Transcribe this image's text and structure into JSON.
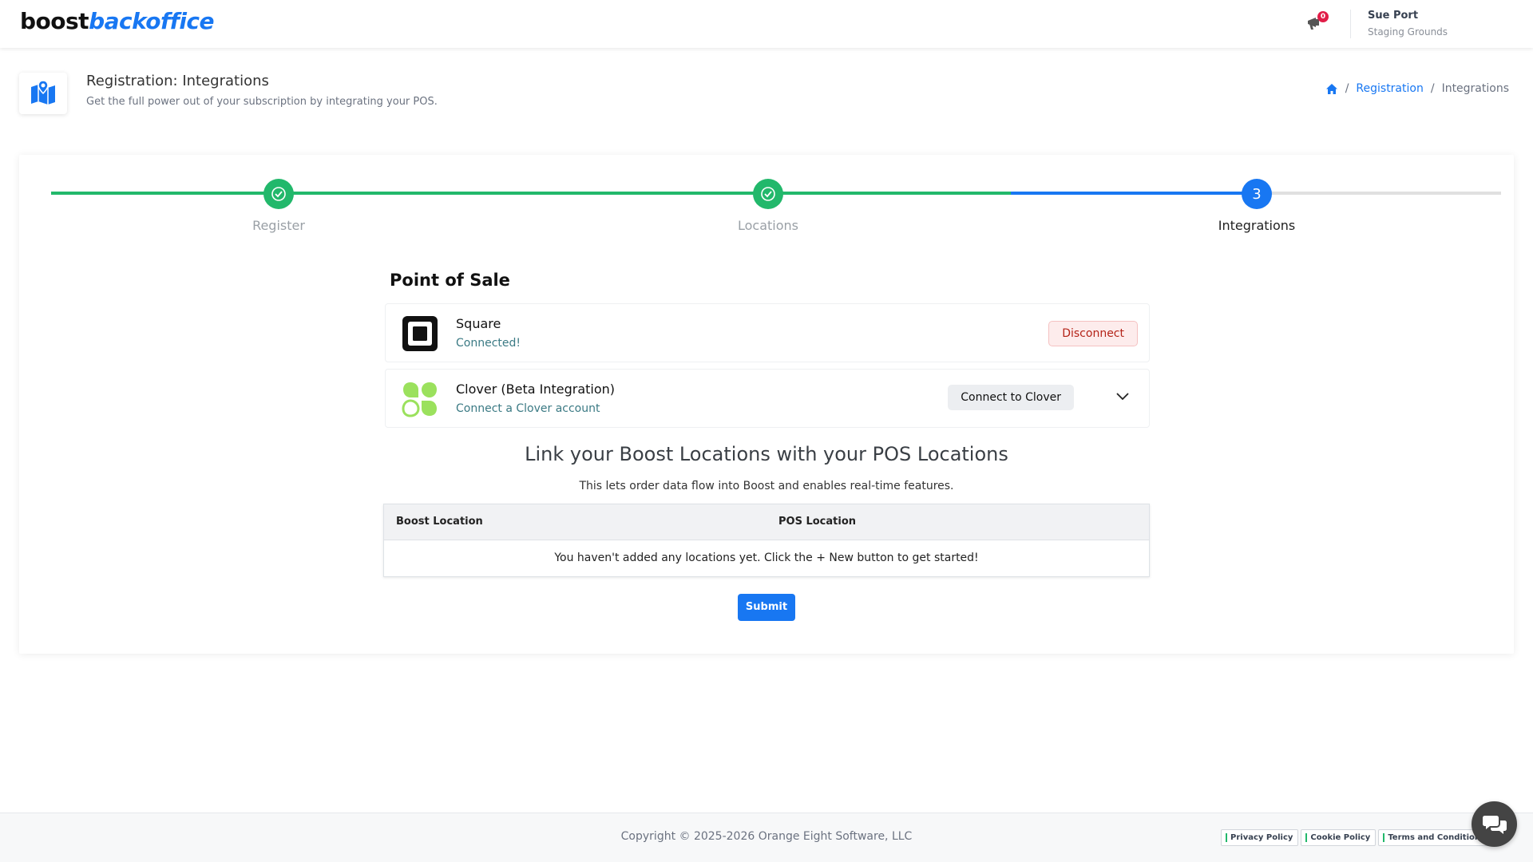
{
  "header": {
    "logo_part1": "boost",
    "logo_part2": "backoffice",
    "notification_count": "0",
    "user_name": "Sue Port",
    "user_org": "Staging Grounds"
  },
  "page": {
    "title": "Registration: Integrations",
    "subtitle": "Get the full power out of your subscription by integrating your POS.",
    "breadcrumb": [
      "Registration",
      "Integrations"
    ]
  },
  "stepper": {
    "steps": [
      {
        "label": "Register",
        "state": "done"
      },
      {
        "label": "Locations",
        "state": "done"
      },
      {
        "label": "Integrations",
        "state": "active",
        "number": "3"
      }
    ]
  },
  "pos": {
    "section_title": "Point of Sale",
    "integrations": [
      {
        "name": "Square",
        "status": "Connected!",
        "action": "Disconnect"
      },
      {
        "name": "Clover (Beta Integration)",
        "status": "Connect a Clover account",
        "action": "Connect to Clover"
      }
    ]
  },
  "link_section": {
    "title": "Link your Boost Locations with your POS Locations",
    "subtitle": "This lets order data flow into Boost and enables real-time features.",
    "columns": [
      "Boost Location",
      "POS Location"
    ],
    "empty_message": "You haven't added any locations yet. Click the + New button to get started!",
    "submit_label": "Submit"
  },
  "footer": {
    "copyright": "Copyright © 2025-2026 Orange Eight Software, LLC",
    "links": [
      "Privacy Policy",
      "Cookie Policy",
      "Terms and Conditions"
    ]
  },
  "colors": {
    "primary": "#1877f2",
    "success": "#22b86b",
    "danger": "#b42318"
  },
  "icons": [
    "map-icon",
    "home-icon",
    "megaphone-icon",
    "check-icon",
    "square-logo-icon",
    "clover-logo-icon",
    "chevron-down-icon",
    "chat-icon"
  ]
}
